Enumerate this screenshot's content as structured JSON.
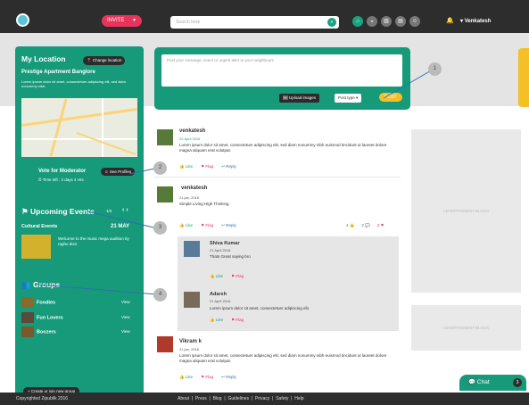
{
  "header": {
    "invite_label": "INVITE",
    "search_placeholder": "Search here",
    "username": "Venkatesh",
    "icons": [
      "home-icon",
      "globe-icon",
      "building-icon",
      "document-icon",
      "people-icon",
      "bell-icon"
    ]
  },
  "sidebar": {
    "location_title": "My Location",
    "change_location": "Change location",
    "place_name": "Prestige Apartment Banglore",
    "place_desc": "Lorem ipsum dolor sit amet, consectetuer adipiscing elit, sed diam nonummy nibh.",
    "vote_title": "Vote for Moderator",
    "time_left": "Time left : 2 days 4 Hrs",
    "see_profiles": "See Profiles",
    "upcoming_title": "Upcoming Events",
    "pager": "1/3",
    "event_name": "Cultural Events",
    "event_date": "21 MAY",
    "event_desc": "Welcome to the music mega audition by raghu dixit.",
    "groups_title": "Groups",
    "groups": [
      {
        "name": "Foodies",
        "action": "View"
      },
      {
        "name": "Fun Lovers",
        "action": "View"
      },
      {
        "name": "Boozers",
        "action": "View"
      }
    ],
    "create_group": "Create or join new group"
  },
  "composer": {
    "placeholder": "Post your message, event or urgent alert to your neighbours",
    "upload_label": "Upload images",
    "post_type_label": "Post type",
    "post_label": "POST",
    "side_tab": "Events tab"
  },
  "posts": [
    {
      "author": "venkatesh",
      "date": "22 April 2016",
      "text": "Lorem ipsum dolor sit amet, consectetuer adipiscing elit, sed diam nonummy nibh euismod tincidunt ut laoreet dolore magna aliquam erat volutpat."
    },
    {
      "author": "venkatesh",
      "date": "21 jan, 2016",
      "text": "Simple Living High Thinking",
      "like_count": "4",
      "comment_count": "2",
      "flag_count": "2"
    },
    {
      "author": "Vikram k",
      "date": "21 jan, 2016",
      "text": "Lorem ipsum dolor sit amet, consectetuer adipiscing elit, sed diam nonummy nibh euismod tincidunt ut laoreet dolore magna aliquam erat volutpat."
    }
  ],
  "comments": [
    {
      "author": "Shiva Kumar",
      "date": "21 April 2016",
      "text": "Thats Great saying bro"
    },
    {
      "author": "Adarsh",
      "date": "21 April 2016",
      "text": "Lorem ipsum dolor sit amet, consectetuer adipiscing elit."
    }
  ],
  "actions": {
    "like": "Like",
    "flag": "Flag",
    "reply": "Reply"
  },
  "ads": {
    "label": "ADVERTISMENT BLOCK"
  },
  "callouts": [
    "1",
    "2",
    "3",
    "4"
  ],
  "footer": {
    "copyright": "Copyrighted Zipublik 2016",
    "links": [
      "About",
      "Press",
      "Blog",
      "Guidelines",
      "Privacy",
      "Safety",
      "Help"
    ]
  },
  "chat": {
    "label": "Chat",
    "count": "3"
  },
  "colors": {
    "primary": "#169a7a",
    "accent": "#e8345a",
    "yellow": "#f4c026",
    "dark": "#2d2d2d"
  }
}
